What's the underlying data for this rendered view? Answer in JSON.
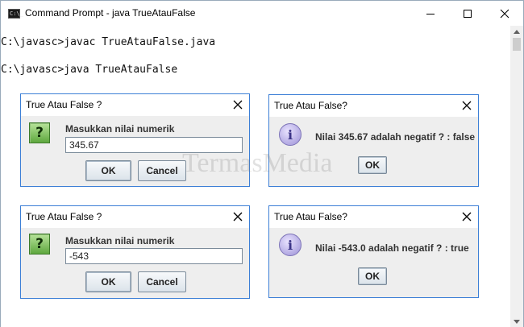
{
  "window": {
    "title": "Command Prompt - java  TrueAtauFalse",
    "icon": "console-icon",
    "icon_text": "C:\\_"
  },
  "console": {
    "lines": [
      "C:\\javasc>javac TrueAtauFalse.java",
      "C:\\javasc>java TrueAtauFalse"
    ]
  },
  "dialogs": {
    "input1": {
      "title": "True Atau False ?",
      "prompt": "Masukkan nilai numerik",
      "value": "345.67",
      "ok_label": "OK",
      "cancel_label": "Cancel"
    },
    "msg1": {
      "title": "True Atau False?",
      "message": "Nilai 345.67 adalah negatif ? : false",
      "ok_label": "OK"
    },
    "input2": {
      "title": "True Atau False ?",
      "prompt": "Masukkan nilai numerik",
      "value": "-543",
      "ok_label": "OK",
      "cancel_label": "Cancel"
    },
    "msg2": {
      "title": "True Atau False?",
      "message": "Nilai -543.0 adalah negatif ? : true",
      "ok_label": "OK"
    }
  },
  "watermark": "TermasMedia",
  "colors": {
    "dialog_border": "#3c7fd6",
    "dialog_bg": "#eeeeee",
    "question_icon": "#5ea73e",
    "info_icon": "#9b90d6"
  }
}
